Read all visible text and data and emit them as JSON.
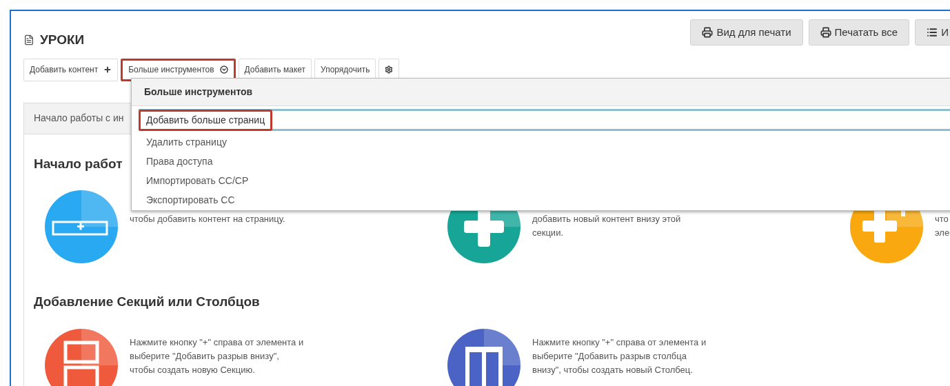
{
  "page": {
    "title": "УРОКИ"
  },
  "header_buttons": [
    {
      "label": "Вид для печати",
      "kind": "print"
    },
    {
      "label": "Печатать все",
      "kind": "print"
    },
    {
      "label": "И",
      "kind": "list"
    }
  ],
  "toolbar": [
    {
      "label": "Добавить контент",
      "kind": "add",
      "highlighted": false
    },
    {
      "label": "Больше инструментов",
      "kind": "more",
      "highlighted": true
    },
    {
      "label": "Добавить макет",
      "kind": "plain",
      "highlighted": false
    },
    {
      "label": "Упорядочить",
      "kind": "plain",
      "highlighted": false
    },
    {
      "kind": "settings",
      "highlighted": false
    }
  ],
  "panel": {
    "tab": "Начало работы с ин",
    "sections": [
      {
        "heading": "Начало работ",
        "items": [
          {
            "kind": "section",
            "color": "#29a9f1",
            "lines": [
              "чтобы добавить контент на страницу."
            ]
          },
          {
            "kind": "add",
            "color": "#16a596",
            "lines": [
              "добавить новый контент внизу этой",
              "секции."
            ]
          },
          {
            "kind": "magic",
            "color": "#f9a90f",
            "lines": [
              "что",
              "эле"
            ]
          }
        ]
      },
      {
        "heading": "Добавление Секций или Столбцов",
        "items": [
          {
            "kind": "rows",
            "color": "#f05a3c",
            "lines": [
              "Нажмите кнопку \"+\" справа от элемента и",
              "выберите \"Добавить разрыв внизу\",",
              "чтобы создать новую Секцию."
            ]
          },
          {
            "kind": "columns",
            "color": "#4a63c4",
            "lines": [
              "Нажмите кнопку \"+\" справа от элемента и",
              "выберите \"Добавить разрыв столбца",
              "внизу\", чтобы создать новый Столбец."
            ]
          }
        ]
      }
    ]
  },
  "dropdown": {
    "title": "Больше инструментов",
    "items": [
      {
        "label": "Добавить больше страниц",
        "selected": true,
        "highlighted": true
      },
      {
        "label": "Удалить страницу",
        "selected": false,
        "highlighted": false
      },
      {
        "label": "Права доступа",
        "selected": false,
        "highlighted": false
      },
      {
        "label": "Импортировать CC/CP",
        "selected": false,
        "highlighted": false
      },
      {
        "label": "Экспортировать CC",
        "selected": false,
        "highlighted": false
      }
    ]
  }
}
